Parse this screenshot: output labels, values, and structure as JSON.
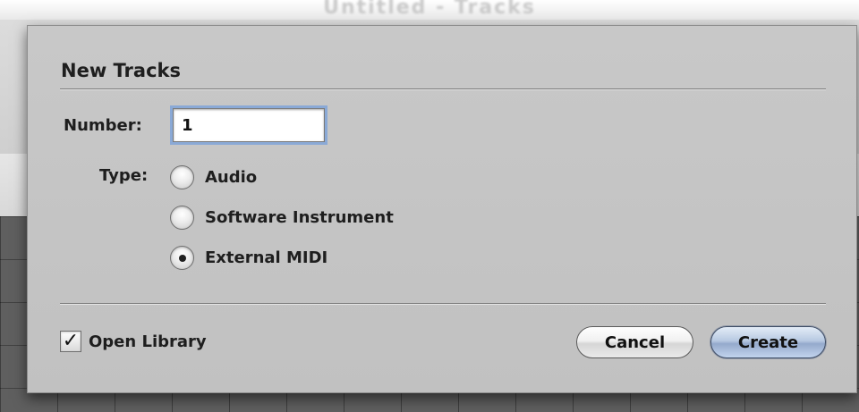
{
  "background": {
    "title": "Untitled - Tracks"
  },
  "dialog": {
    "heading": "New Tracks",
    "number_label": "Number:",
    "number_value": "1",
    "type_label": "Type:",
    "type_options": [
      {
        "label": "Audio",
        "selected": false
      },
      {
        "label": "Software Instrument",
        "selected": false
      },
      {
        "label": "External MIDI",
        "selected": true
      }
    ],
    "open_library_label": "Open Library",
    "open_library_checked": true,
    "cancel_label": "Cancel",
    "create_label": "Create"
  },
  "colors": {
    "sheet_bg": "#c5c5c5",
    "focus_ring": "#8aa9d6",
    "default_button": "#a9bcdb"
  }
}
